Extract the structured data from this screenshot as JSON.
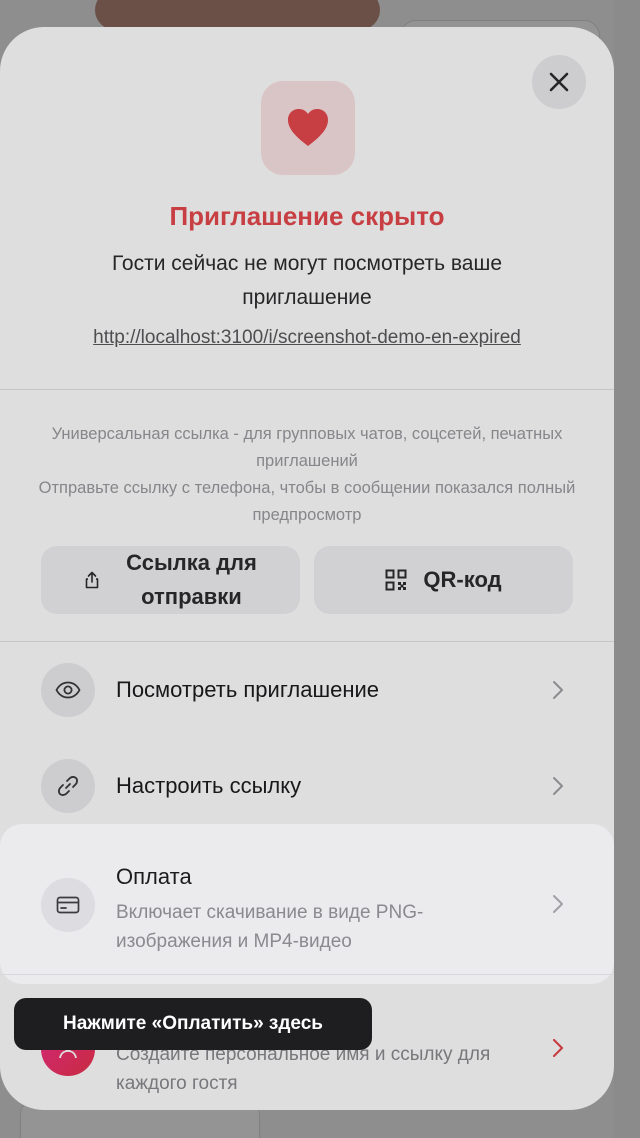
{
  "modal": {
    "close_icon": "close-icon",
    "status_icon": "heart-icon",
    "title": "Приглашение скрыто",
    "subtitle": "Гости сейчас не могут посмотреть ваше приглашение",
    "invite_link": "http://localhost:3100/i/screenshot-demo-en-expired",
    "share_hint_1": "Универсальная ссылка - для групповых чатов, соцсетей, печатных приглашений",
    "share_hint_2": "Отправьте ссылку с телефона, чтобы в сообщении показался полный предпросмотр",
    "share_button": {
      "icon": "share-icon",
      "label_line1": "Ссылка для",
      "label_line2": "отправки"
    },
    "qr_button": {
      "icon": "qr-code-icon",
      "label": "QR-код"
    },
    "menu": [
      {
        "icon": "eye-icon",
        "title": "Посмотреть приглашение"
      },
      {
        "icon": "link-icon",
        "title": "Настроить ссылку"
      },
      {
        "icon": "card-icon",
        "title": "Оплата",
        "description": "Включает скачивание в виде PNG-изображения и MP4-видео"
      },
      {
        "icon": "guest-icon",
        "title": "",
        "description": "Создайте персональное имя и ссылку для каждого гостя"
      }
    ]
  },
  "tooltip": {
    "text": "Нажмите «Оплатить» здесь"
  },
  "colors": {
    "accent_red": "#e5484d",
    "heart_tile": "#fbe3e4",
    "tooltip_bg": "#1e1e20"
  }
}
